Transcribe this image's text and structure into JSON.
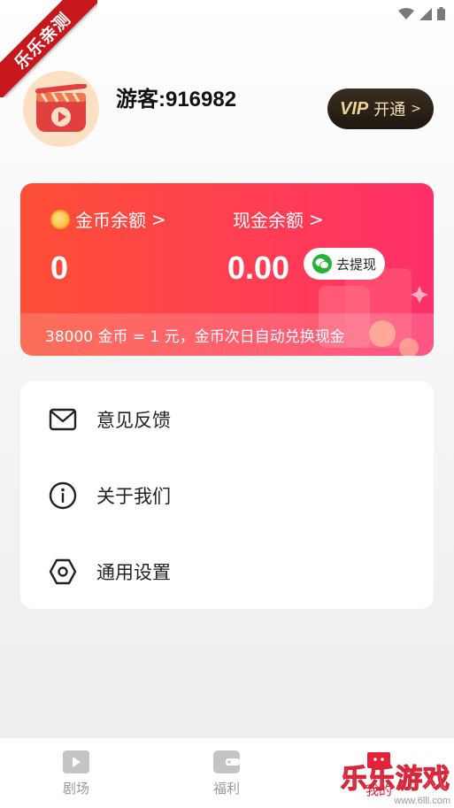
{
  "ribbon": {
    "text": "乐乐亲测"
  },
  "profile": {
    "username": "游客:916982"
  },
  "vip": {
    "badge": "VIP",
    "label": "开通",
    "chevron": ">"
  },
  "balance": {
    "coin_label": "金币余额",
    "coin_value": "0",
    "cash_label": "现金余额",
    "cash_value": "0.00",
    "chevron": ">",
    "withdraw_label": "去提现",
    "note": "38000 金币 = 1 元，金币次日自动兑换现金"
  },
  "menu": {
    "items": [
      {
        "label": "意见反馈",
        "icon": "mail-icon"
      },
      {
        "label": "关于我们",
        "icon": "info-icon"
      },
      {
        "label": "通用设置",
        "icon": "hexagon-settings-icon"
      }
    ]
  },
  "tabs": [
    {
      "label": "剧场",
      "icon": "play-icon"
    },
    {
      "label": "福利",
      "icon": "wallet-icon"
    },
    {
      "label": "我的",
      "icon": "profile-icon"
    }
  ],
  "watermark": {
    "text": "乐乐游戏",
    "url": "www.6lll.com"
  },
  "colors": {
    "card_start": "#fd4f35",
    "card_end": "#ff2f6a",
    "vip_bg": "#1e1710",
    "vip_text": "#f1d39a",
    "wechat": "#26b239",
    "tab_active": "#e8203a"
  }
}
